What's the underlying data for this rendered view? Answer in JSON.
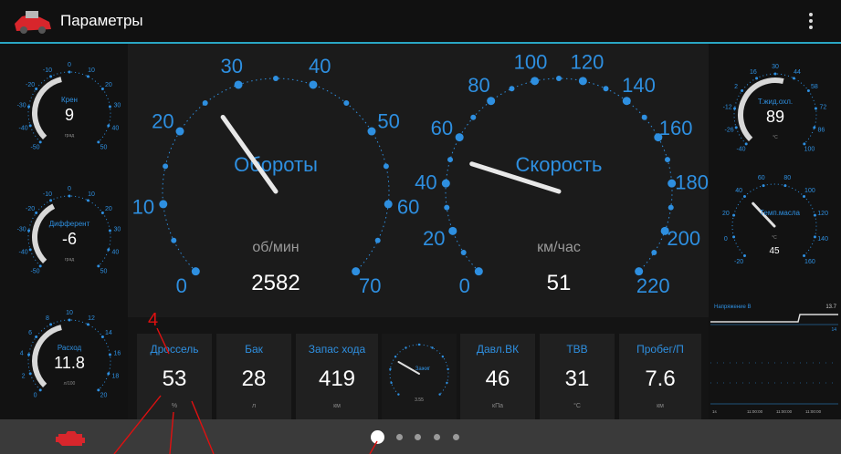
{
  "app": {
    "title": "Параметры"
  },
  "left_gauges": [
    {
      "label": "Крен",
      "value": "9",
      "unit": "град",
      "ticks": [
        "-50",
        "-40",
        "-30",
        "-20",
        "-10",
        "0",
        "10",
        "20",
        "30",
        "40",
        "50"
      ]
    },
    {
      "label": "Дифферент",
      "value": "-6",
      "unit": "град",
      "ticks": [
        "-50",
        "-40",
        "-30",
        "-20",
        "-10",
        "0",
        "10",
        "20",
        "30",
        "40",
        "50"
      ]
    },
    {
      "label": "Расход",
      "value": "11.8",
      "unit": "л/100",
      "ticks": [
        "0",
        "2",
        "4",
        "6",
        "8",
        "10",
        "12",
        "14",
        "16",
        "18",
        "20"
      ]
    }
  ],
  "rpm_gauge": {
    "label": "Обороты",
    "unit": "об/мин",
    "value": "2582",
    "ticks": [
      "0",
      "10",
      "20",
      "30",
      "40",
      "50",
      "60",
      "70"
    ],
    "needle_fraction": 0.369
  },
  "speed_gauge": {
    "label": "Скорость",
    "unit": "км/час",
    "value": "51",
    "ticks": [
      "0",
      "20",
      "40",
      "60",
      "80",
      "100",
      "120",
      "140",
      "160",
      "180",
      "200",
      "220"
    ],
    "needle_fraction": 0.232
  },
  "right_gauges": [
    {
      "label": "Т.жид.охл.",
      "value": "89",
      "unit": "°C",
      "ticks": [
        "-40",
        "-26",
        "-12",
        "2",
        "16",
        "30",
        "44",
        "58",
        "72",
        "86",
        "100"
      ]
    },
    {
      "label": "Темп.масла",
      "value": "45",
      "unit": "°C",
      "ticks": [
        "-20",
        "0",
        "20",
        "40",
        "60",
        "80",
        "100",
        "120",
        "140",
        "160"
      ]
    }
  ],
  "voltage_chart": {
    "label": "Напряжение В",
    "value": "13.7",
    "min": "14",
    "x_labels": [
      "1s",
      "11:00:00",
      "11:00:00",
      "11:00:00"
    ]
  },
  "tiles": [
    {
      "label": "Дроссель",
      "value": "53",
      "unit": "%"
    },
    {
      "label": "Бак",
      "value": "28",
      "unit": "л"
    },
    {
      "label": "Запас хода",
      "value": "419",
      "unit": "км"
    },
    {
      "label": "Давл.ВК",
      "value": "46",
      "unit": "кПа"
    },
    {
      "label": "ТВВ",
      "value": "31",
      "unit": "°C"
    },
    {
      "label": "Пробег/П",
      "value": "7.6",
      "unit": "км"
    }
  ],
  "small_center_gauge": {
    "label": "Зажиг",
    "value": "3.55"
  },
  "annotation": {
    "label": "4"
  },
  "pager": {
    "count": 5,
    "active": 0
  },
  "colors": {
    "accent": "#2e8fe0",
    "annotation": "#e01010",
    "appbar_line": "#2aa6c4",
    "logo": "#d8262c"
  },
  "icons": {
    "app_logo": "car-logo-icon",
    "menu": "overflow-menu-icon",
    "bottom_left": "engine-check-icon"
  }
}
